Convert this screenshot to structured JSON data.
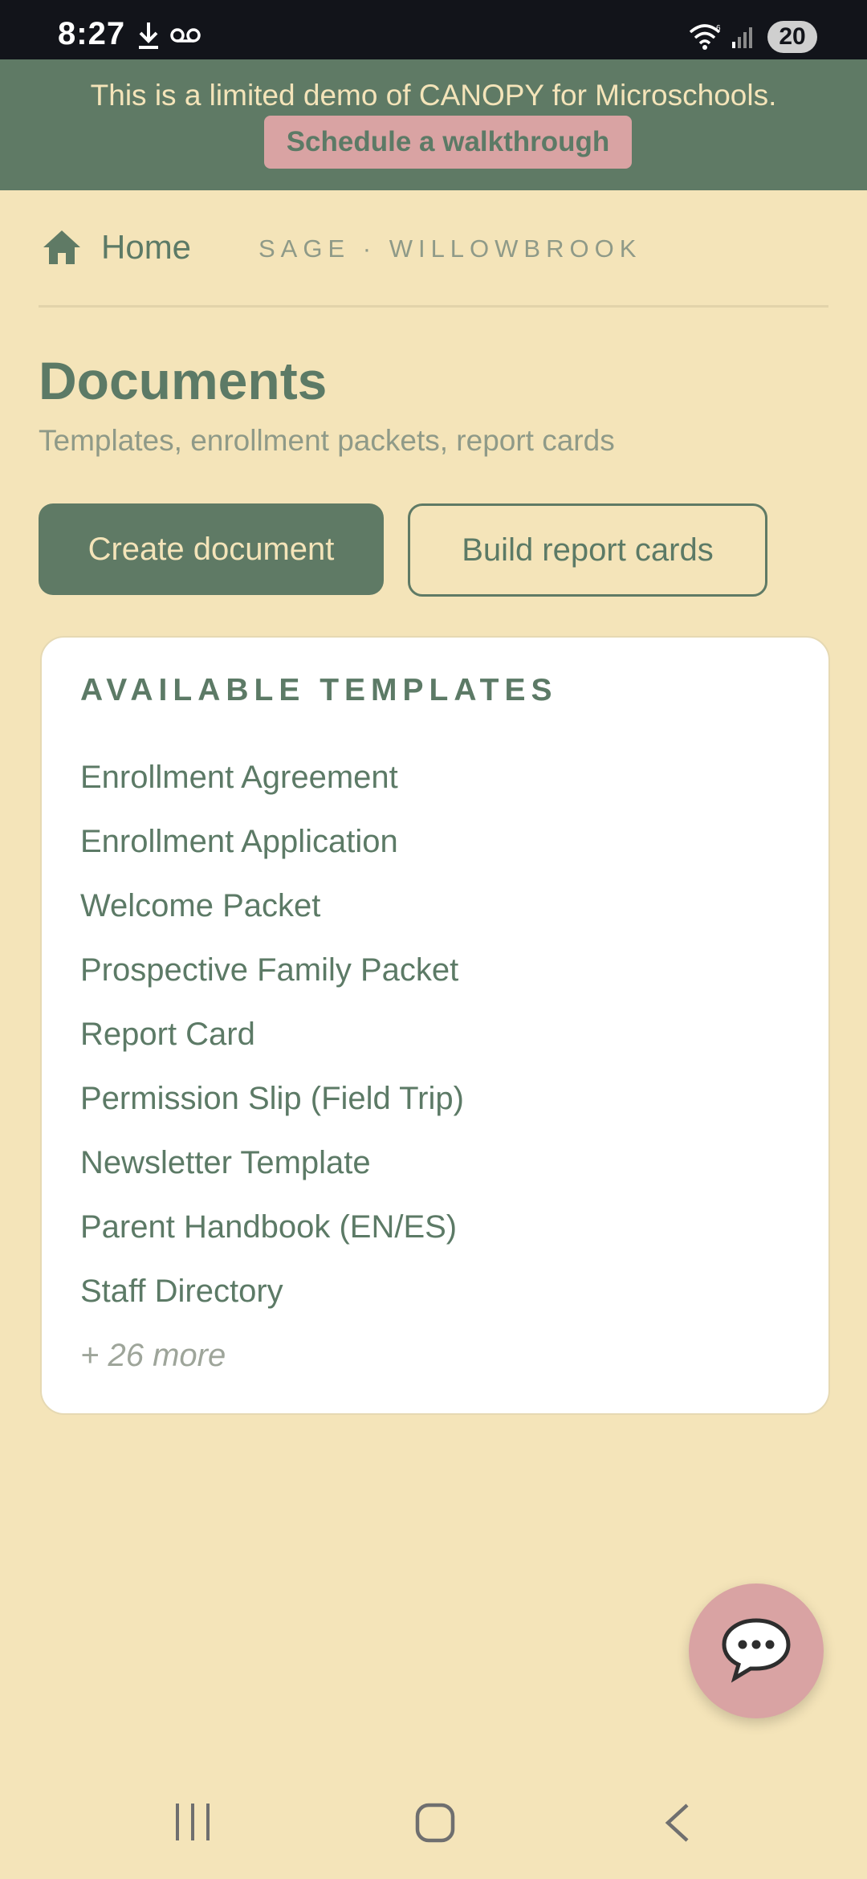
{
  "status_bar": {
    "time": "8:27",
    "battery": "20",
    "icons": [
      "download-icon",
      "voicemail-icon",
      "wifi-icon",
      "signal-icon"
    ]
  },
  "demo_banner": {
    "text": "This is a limited demo of CANOPY for Microschools.",
    "cta_label": "Schedule a walkthrough"
  },
  "header": {
    "home_label": "Home",
    "school_label": "SAGE · WILLOWBROOK"
  },
  "page": {
    "title": "Documents",
    "subtitle": "Templates, enrollment packets, report cards"
  },
  "actions": {
    "create_label": "Create document",
    "build_label": "Build report cards"
  },
  "templates": {
    "heading": "AVAILABLE TEMPLATES",
    "items": [
      "Enrollment Agreement",
      "Enrollment Application",
      "Welcome Packet",
      "Prospective Family Packet",
      "Report Card",
      "Permission Slip (Field Trip)",
      "Newsletter Template",
      "Parent Handbook (EN/ES)",
      "Staff Directory"
    ],
    "more_label": "+ 26 more"
  },
  "colors": {
    "background": "#f4e4b9",
    "primary_green": "#5f7a65",
    "accent_pink": "#d9a3a3",
    "card": "#ffffff"
  }
}
